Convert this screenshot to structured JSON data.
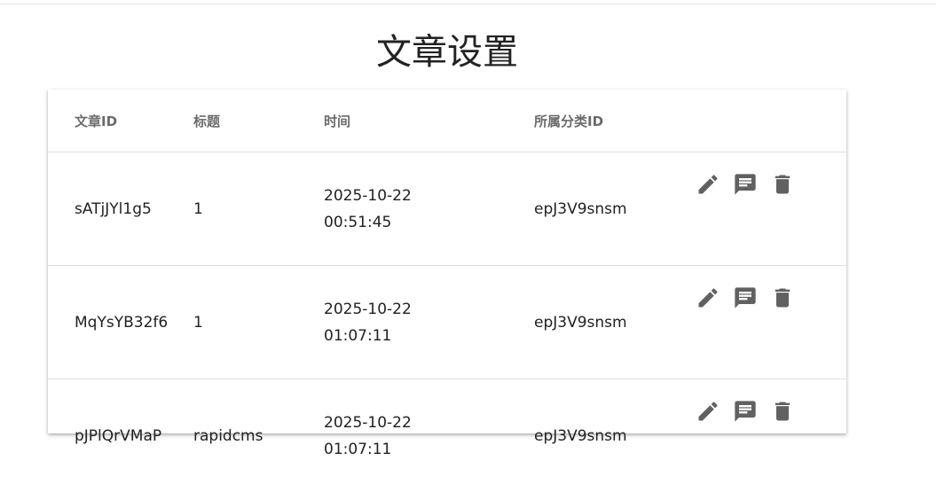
{
  "page": {
    "title": "文章设置"
  },
  "table": {
    "headers": {
      "id": "文章ID",
      "title": "标题",
      "time": "时间",
      "category": "所属分类ID"
    },
    "rows": [
      {
        "id": "sATjJYl1g5",
        "title": "1",
        "date": "2025-10-22",
        "clock": "00:51:45",
        "category": "epJ3V9snsm"
      },
      {
        "id": "MqYsYB32f6",
        "title": "1",
        "date": "2025-10-22",
        "clock": "01:07:11",
        "category": "epJ3V9snsm"
      },
      {
        "id": "pJPlQrVMaP",
        "title": "rapidcms",
        "date": "2025-10-22",
        "clock": "01:07:11",
        "category": "epJ3V9snsm"
      }
    ],
    "row_actions": [
      "edit-icon",
      "comment-icon",
      "delete-icon"
    ]
  },
  "colors": {
    "icon": "#616161",
    "header_text": "#6b6b6b",
    "divider": "#e0e0e0"
  }
}
